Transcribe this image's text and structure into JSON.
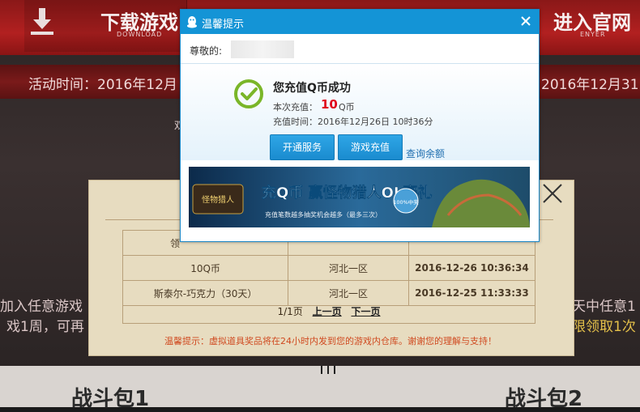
{
  "background": {
    "download_title": "下载游戏",
    "download_sub": "DOWNLOAD",
    "enter_title": "进入官网",
    "enter_sub": "ENYER",
    "activity_left": "活动时间：2016年12月",
    "activity_right": "2016年12月31",
    "side_char": "双",
    "side_left_1": "加入任意游戏",
    "side_left_2": "戏1周，可再",
    "side_right_1": "天中任意1",
    "side_right_2": "限领取1次",
    "pack1": "战斗包1",
    "pack2": "战斗包2"
  },
  "prize_panel": {
    "header_partial": "领",
    "rows": [
      {
        "item": "10Q币",
        "server": "河北一区",
        "time": "2016-12-26 10:36:34"
      },
      {
        "item": "斯泰尔-巧克力（30天）",
        "server": "河北一区",
        "time": "2016-12-25 11:33:33"
      }
    ],
    "pager": {
      "page": "1/1页",
      "prev": "上一页",
      "next": "下一页"
    },
    "note": "温馨提示：虚拟道具奖品将在24小时内发到您的游戏内仓库。谢谢您的理解与支持！"
  },
  "dialog": {
    "title": "温馨提示",
    "greeting": "尊敬的:",
    "success": "您充值Q币成功",
    "amount_label": "本次充值：",
    "amount_value": "10",
    "amount_unit": "Q币",
    "datetime": "充值时间：2016年12月26日 10时36分",
    "btn_service": "开通服务",
    "btn_recharge": "游戏充值",
    "query_balance": "查询余额",
    "banner": {
      "main": "充Q币 赢怪物猎人OL豪礼",
      "sub": "充值笔数越多抽奖机会越多（最多三次）",
      "badge": "100%中奖",
      "logo": "怪物猎人"
    }
  }
}
